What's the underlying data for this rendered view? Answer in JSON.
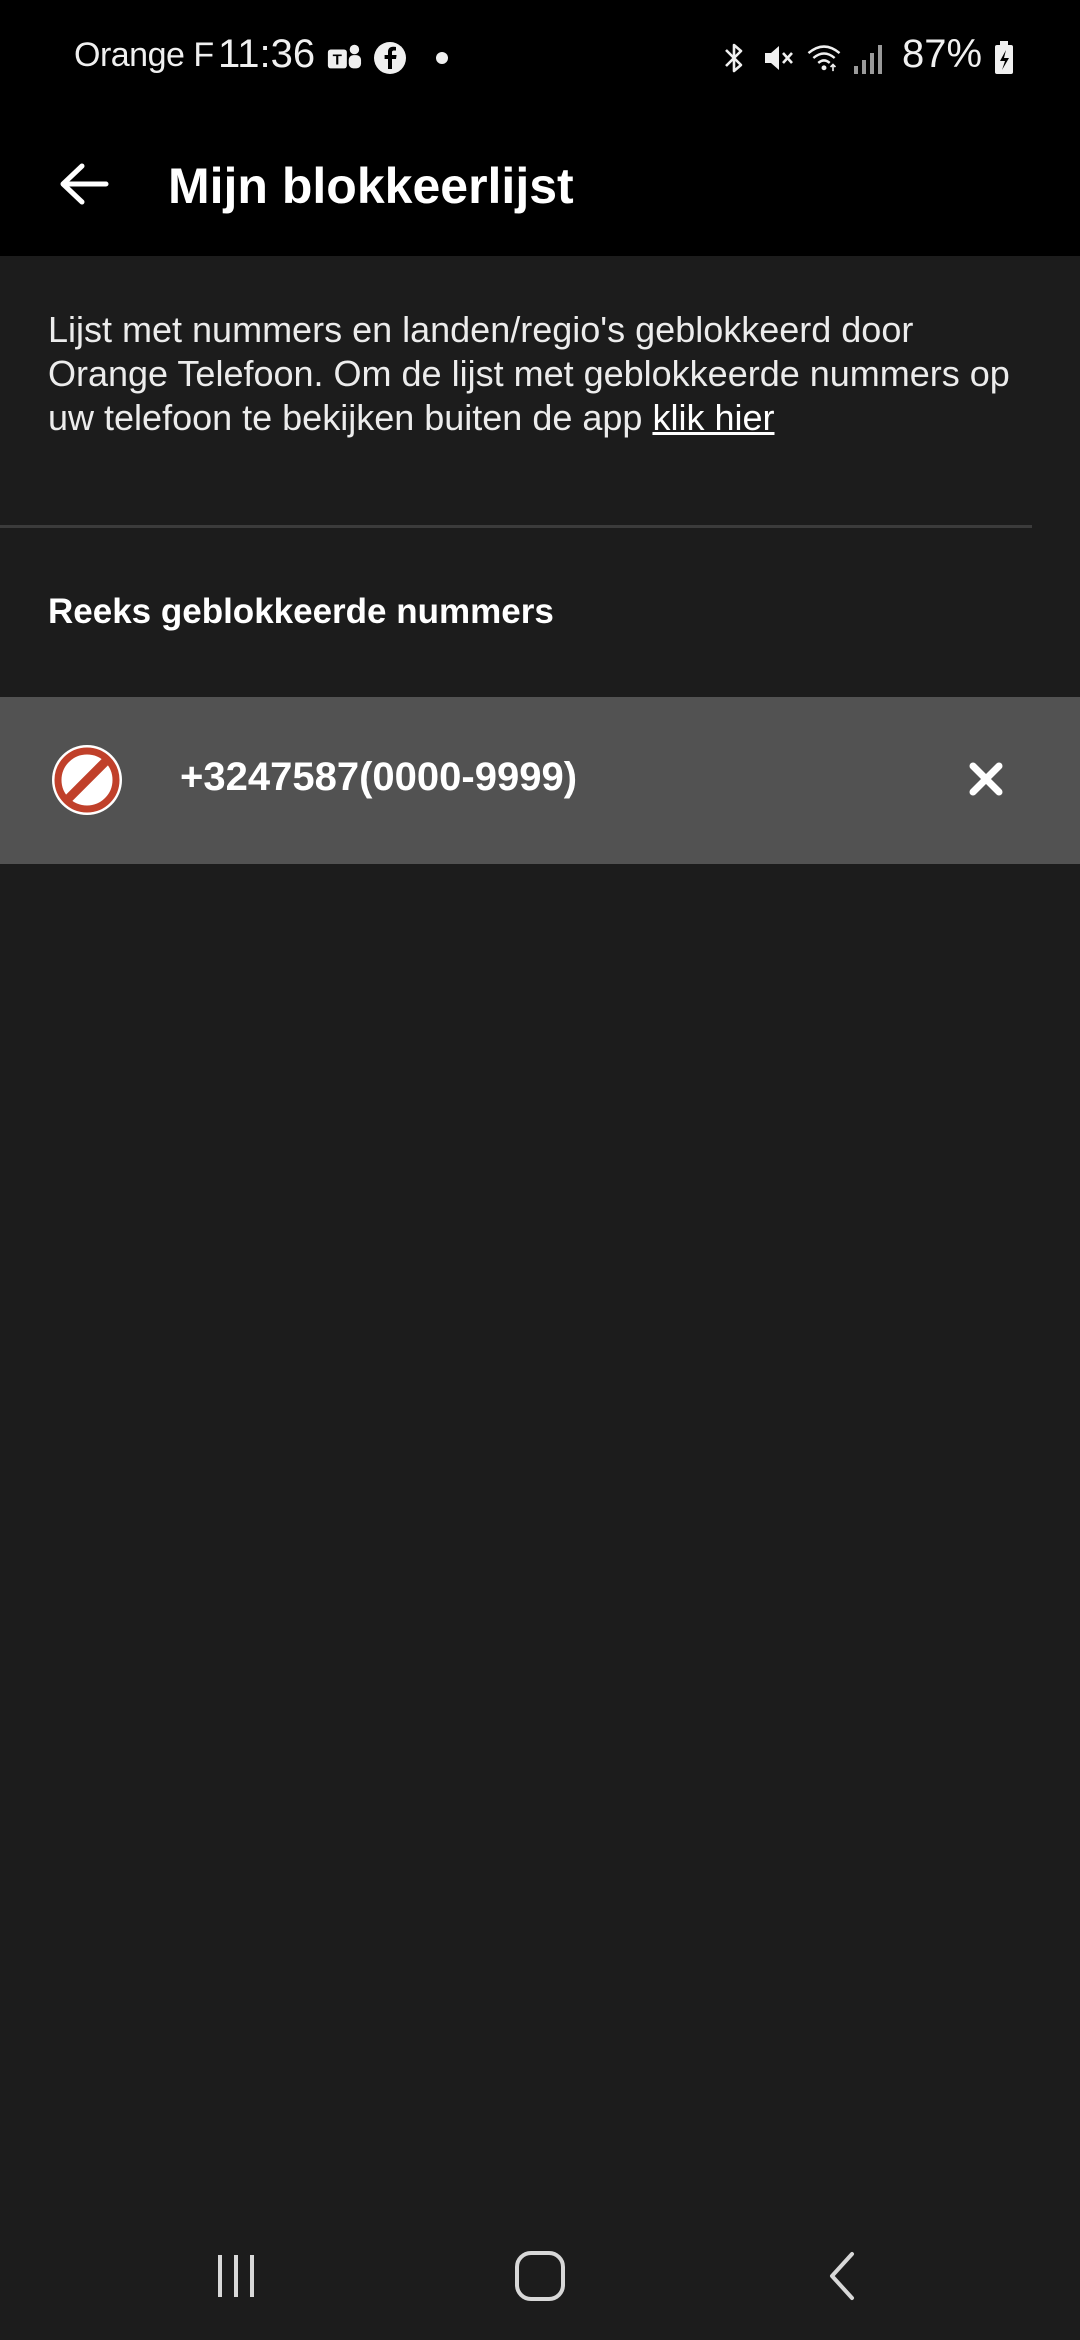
{
  "status_bar": {
    "carrier": "Orange F",
    "time": "11:36",
    "battery": "87%",
    "icons": [
      "teams-icon",
      "facebook-icon",
      "dot-icon",
      "bluetooth-icon",
      "mute-icon",
      "wifi-icon",
      "signal-icon",
      "battery-icon"
    ]
  },
  "app_bar": {
    "title": "Mijn blokkeerlijst",
    "back_icon": "back-arrow-icon"
  },
  "description": {
    "text": "Lijst met nummers en landen/regio's geblokkeerd door Orange Telefoon. Om de lijst met geblokkeerde nummers op uw telefoon te bekijken buiten de app ",
    "link": "klik hier"
  },
  "section": {
    "header": "Reeks geblokkeerde nummers"
  },
  "blocked_items": [
    {
      "number": "+3247587(0000-9999)",
      "icon": "block-icon",
      "action_icon": "close-icon"
    }
  ],
  "colors": {
    "background": "#1c1c1c",
    "bar": "#000000",
    "row_highlight": "#525252",
    "block_icon_red": "#c0402a"
  },
  "nav_bar": {
    "icons": [
      "recent-apps-icon",
      "home-icon",
      "back-icon"
    ]
  }
}
